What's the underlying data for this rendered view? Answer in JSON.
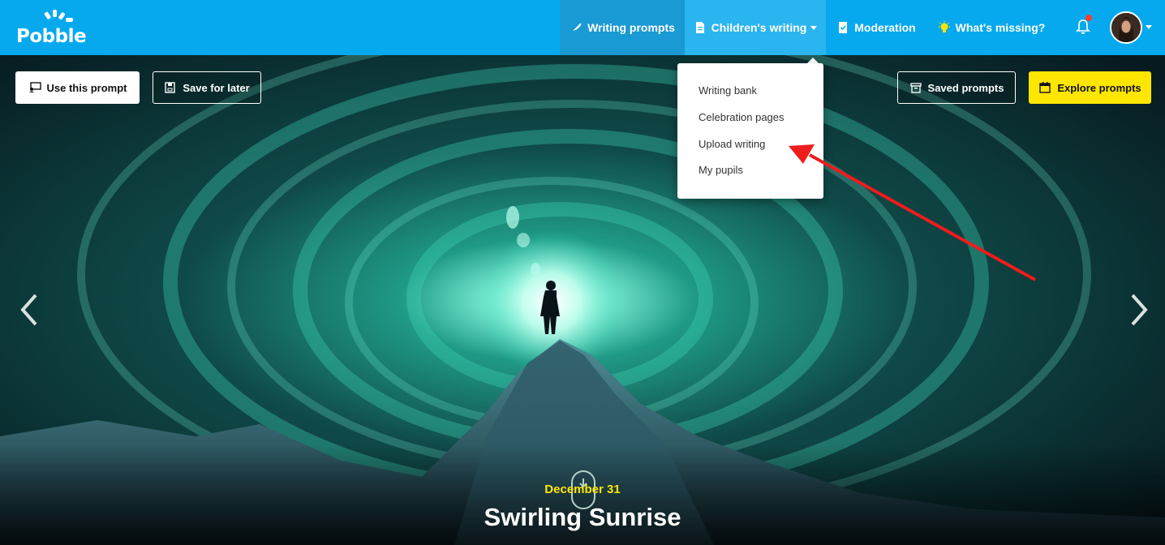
{
  "app": {
    "logo_text": "Pobble"
  },
  "nav": {
    "items": [
      {
        "label": "Writing prompts",
        "icon": "feather-icon"
      },
      {
        "label": "Children's writing",
        "icon": "document-icon"
      },
      {
        "label": "Moderation",
        "icon": "checklist-icon"
      },
      {
        "label": "What's missing?",
        "icon": "lightbulb-icon"
      }
    ],
    "notification_icon": "bell-icon"
  },
  "dropdown": {
    "items": [
      "Writing bank",
      "Celebration pages",
      "Upload writing",
      "My pupils"
    ]
  },
  "actions": {
    "use_prompt": "Use this prompt",
    "save_later": "Save for later",
    "saved_prompts": "Saved prompts",
    "explore_prompts": "Explore prompts"
  },
  "hero": {
    "date": "December 31",
    "title": "Swirling Sunrise"
  },
  "colors": {
    "nav_bg": "#07a9ee",
    "accent_yellow": "#ffe600",
    "annotation_red": "#ee1c1c"
  }
}
